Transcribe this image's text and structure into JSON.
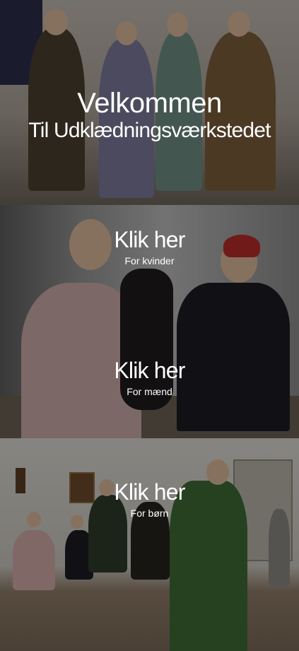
{
  "hero": {
    "title": "Velkommen",
    "subtitle": "Til Udklædningsværkstedet"
  },
  "sections": [
    {
      "link_label": "Klik her",
      "caption": "For kvinder"
    },
    {
      "link_label": "Klik her",
      "caption": "For mænd"
    },
    {
      "link_label": "Klik her",
      "caption": "For børn"
    }
  ],
  "colors": {
    "text": "#ffffff",
    "overlay": "rgba(0,0,0,0.38)"
  }
}
